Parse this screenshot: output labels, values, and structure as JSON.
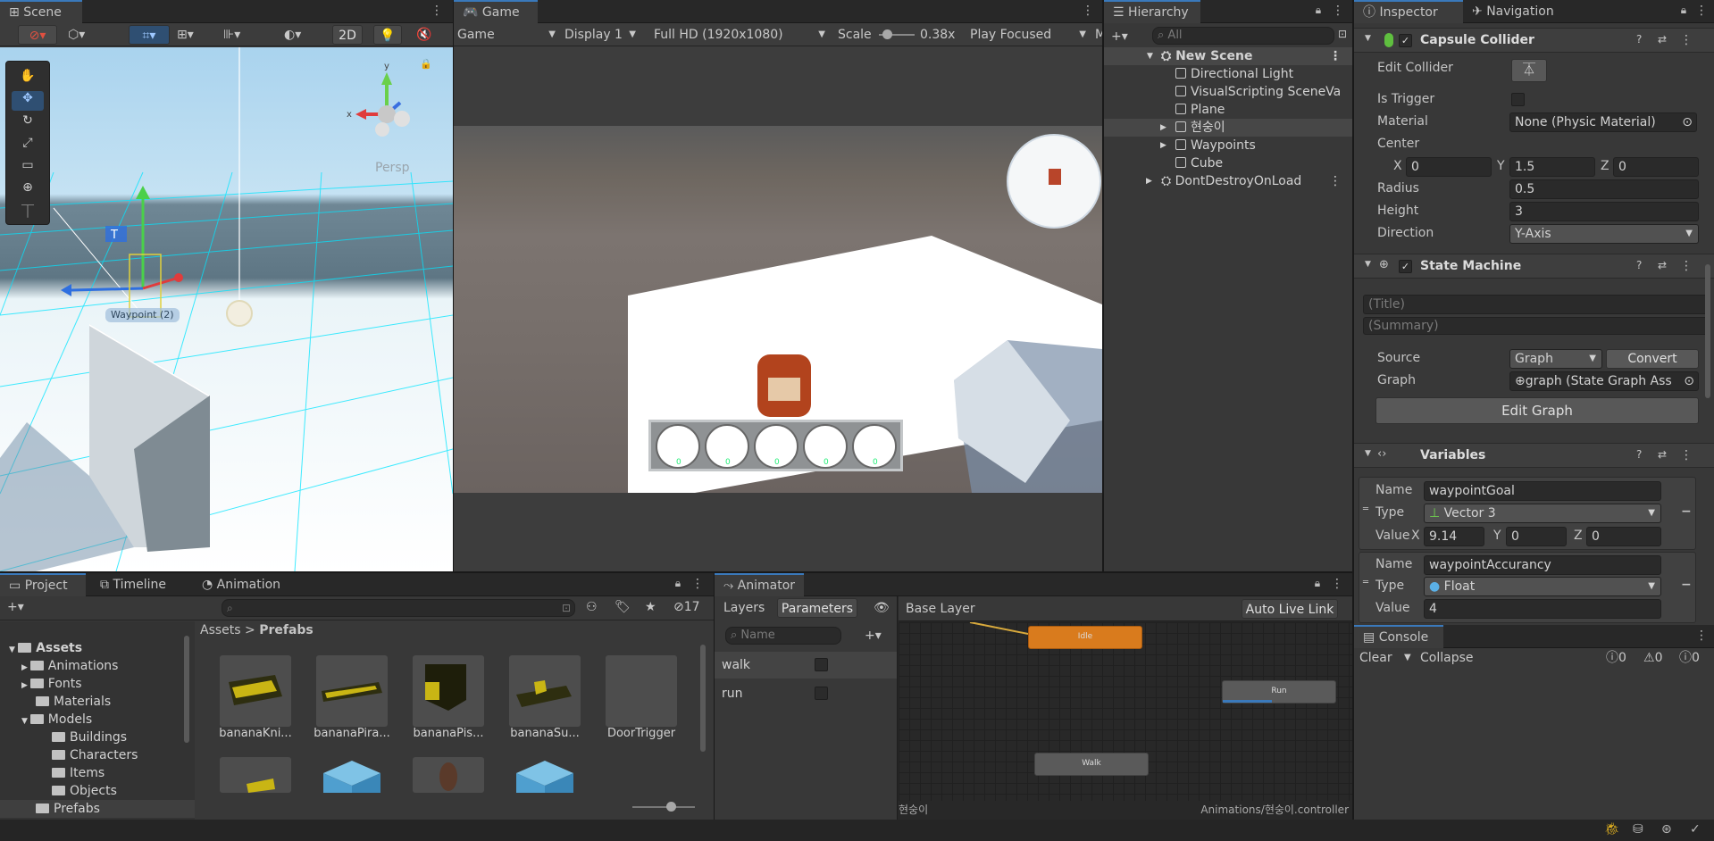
{
  "scene": {
    "tab": "Scene",
    "btn_2d": "2D",
    "persp": "Persp",
    "waypoint_label": "Waypoint (2)",
    "axis_y": "y",
    "axis_x": "x"
  },
  "game": {
    "tab": "Game",
    "mode": "Game",
    "display": "Display 1",
    "resolution": "Full HD (1920x1080)",
    "scale_label": "Scale",
    "scale_value": "0.38x",
    "play_focused": "Play Focused",
    "more": "M",
    "hud_slots": [
      "0",
      "0",
      "0",
      "0",
      "0"
    ]
  },
  "hierarchy": {
    "tab": "Hierarchy",
    "search_placeholder": "All",
    "items": [
      {
        "label": "New Scene"
      },
      {
        "label": "Directional Light"
      },
      {
        "label": "VisualScripting SceneVa"
      },
      {
        "label": "Plane"
      },
      {
        "label": "현숭이"
      },
      {
        "label": "Waypoints"
      },
      {
        "label": "Cube"
      },
      {
        "label": "DontDestroyOnLoad"
      }
    ]
  },
  "inspector": {
    "tab_inspector": "Inspector",
    "tab_navigation": "Navigation",
    "capsule": {
      "title": "Capsule Collider",
      "edit_collider": "Edit Collider",
      "is_trigger": "Is Trigger",
      "material_label": "Material",
      "material_value": "None (Physic Material)",
      "center_label": "Center",
      "cx_label": "X",
      "cx": "0",
      "cy_label": "Y",
      "cy": "1.5",
      "cz_label": "Z",
      "cz": "0",
      "radius_label": "Radius",
      "radius": "0.5",
      "height_label": "Height",
      "height": "3",
      "direction_label": "Direction",
      "direction": "Y-Axis"
    },
    "state_machine": {
      "title": "State Machine",
      "title_placeholder": "(Title)",
      "summary_placeholder": "(Summary)",
      "source_label": "Source",
      "source_value": "Graph",
      "convert": "Convert",
      "graph_label": "Graph",
      "graph_value": "graph (State Graph Ass",
      "edit_graph": "Edit Graph"
    },
    "variables": {
      "title": "Variables",
      "var1": {
        "name_label": "Name",
        "name": "waypointGoal",
        "type_label": "Type",
        "type": "Vector 3",
        "value_label": "Value",
        "x_label": "X",
        "x": "9.14",
        "y_label": "Y",
        "y": "0",
        "z_label": "Z",
        "z": "0"
      },
      "var2": {
        "name_label": "Name",
        "name": "waypointAccurancy",
        "type_label": "Type",
        "type": "Float",
        "value_label": "Value",
        "value": "4"
      }
    }
  },
  "console": {
    "tab": "Console",
    "clear": "Clear",
    "collapse": "Collapse",
    "info_count": "0",
    "warn_count": "0",
    "error_count": "0"
  },
  "project": {
    "tab_project": "Project",
    "tab_timeline": "Timeline",
    "tab_animation": "Animation",
    "hidden_count": "17",
    "breadcrumb_root": "Assets",
    "breadcrumb_sep": ">",
    "breadcrumb_current": "Prefabs",
    "tree": [
      {
        "label": "Assets"
      },
      {
        "label": "Animations"
      },
      {
        "label": "Fonts"
      },
      {
        "label": "Materials"
      },
      {
        "label": "Models"
      },
      {
        "label": "Buildings"
      },
      {
        "label": "Characters"
      },
      {
        "label": "Items"
      },
      {
        "label": "Objects"
      },
      {
        "label": "Prefabs"
      }
    ],
    "assets": [
      {
        "label": "bananaKni..."
      },
      {
        "label": "bananaPira..."
      },
      {
        "label": "bananaPis..."
      },
      {
        "label": "bananaSu..."
      },
      {
        "label": "DoorTrigger"
      }
    ]
  },
  "animator": {
    "tab": "Animator",
    "layers": "Layers",
    "parameters": "Parameters",
    "base_layer": "Base Layer",
    "auto_live_link": "Auto Live Link",
    "search_placeholder": "Name",
    "params": [
      {
        "label": "walk"
      },
      {
        "label": "run"
      }
    ],
    "states": {
      "idle": "Idle",
      "run": "Run",
      "walk": "Walk"
    },
    "footer_left": "현숭이",
    "footer_right": "Animations/현숭이.controller",
    "colors": {
      "idle": "#d97b1d",
      "run_progress": "#3a79bb"
    }
  }
}
